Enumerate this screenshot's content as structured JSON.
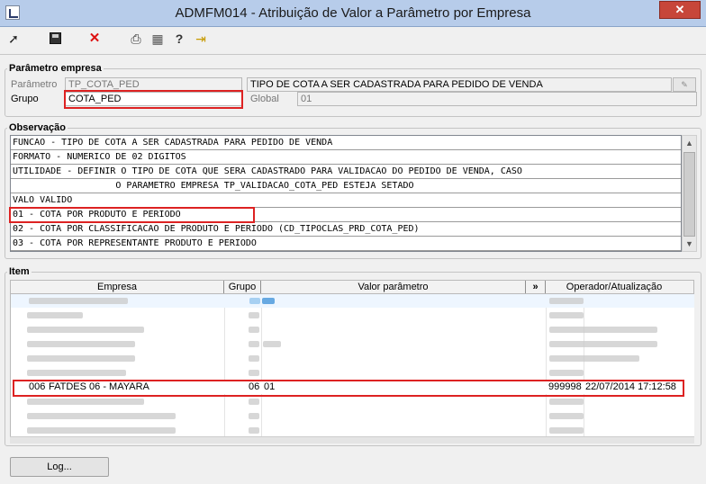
{
  "window": {
    "title": "ADMFM014 - Atribuição de Valor a Parâmetro por Empresa",
    "close_glyph": "✕"
  },
  "toolbar": {
    "icons": [
      "arrow-icon",
      "save-icon",
      "delete-icon",
      "print-icon",
      "grid-icon",
      "help-icon",
      "exit-icon"
    ]
  },
  "param_section": {
    "title": "Parâmetro empresa",
    "parametro_label": "Parâmetro",
    "parametro_value": "TP_COTA_PED",
    "descricao_value": "TIPO DE COTA A SER CADASTRADA PARA PEDIDO DE VENDA",
    "grupo_label": "Grupo",
    "grupo_value": "COTA_PED",
    "global_label": "Global",
    "global_value": "01"
  },
  "obs_section": {
    "title": "Observação",
    "lines": [
      "FUNCAO - TIPO DE COTA A SER CADASTRADA PARA PEDIDO DE VENDA",
      "FORMATO - NUMERICO DE 02 DIGITOS",
      "UTILIDADE - DEFINIR O TIPO DE COTA QUE SERA CADASTRADO PARA VALIDACAO DO PEDIDO DE VENDA, CASO",
      "                   O PARAMETRO EMPRESA TP_VALIDACAO_COTA_PED ESTEJA SETADO",
      "VALO VALIDO",
      "01 - COTA POR PRODUTO E PERIODO",
      "02 - COTA POR CLASSIFICACAO DE PRODUTO E PERIODO (CD_TIPOCLAS_PRD_COTA_PED)",
      "03 - COTA POR REPRESENTANTE PRODUTO E PERIODO"
    ]
  },
  "item_section": {
    "title": "Item",
    "columns": {
      "empresa": "Empresa",
      "grupo": "Grupo",
      "valor": "Valor parâmetro",
      "expand": "»",
      "operador": "Operador/Atualização"
    },
    "highlight_row": {
      "code": "006",
      "name": "FATDES 06 - MAYARA",
      "grupo": "06",
      "valor": "01",
      "operador": "999998",
      "data": "22/07/2014 17:12:58"
    }
  },
  "footer": {
    "log_label": "Log..."
  },
  "colors": {
    "highlight": "#d22222",
    "titlebar": "#b7ccea",
    "close": "#c7463a"
  }
}
